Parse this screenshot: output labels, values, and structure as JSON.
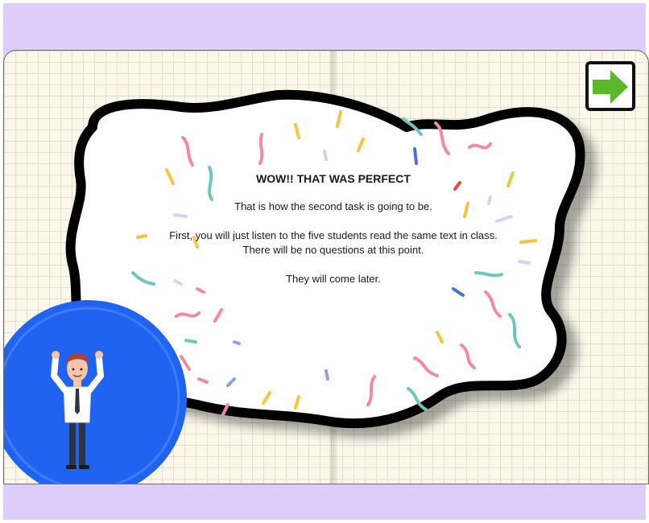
{
  "message": {
    "title": "WOW!! THAT WAS PERFECT",
    "line1": "That is how the second task is going to be.",
    "line2": "First, you will just listen to the five students read the same text in class.",
    "line3": "There will be no questions at this point.",
    "line4": "They will come later."
  },
  "navigation": {
    "next_icon": "right-arrow-icon"
  },
  "avatar": {
    "icon": "presenter-character"
  },
  "colors": {
    "background": "#dccdfb",
    "paper": "#fbf8ea",
    "grid": "#e2dfd0",
    "arrow": "#5cb82a",
    "avatar_circle": "#1f63f0"
  }
}
